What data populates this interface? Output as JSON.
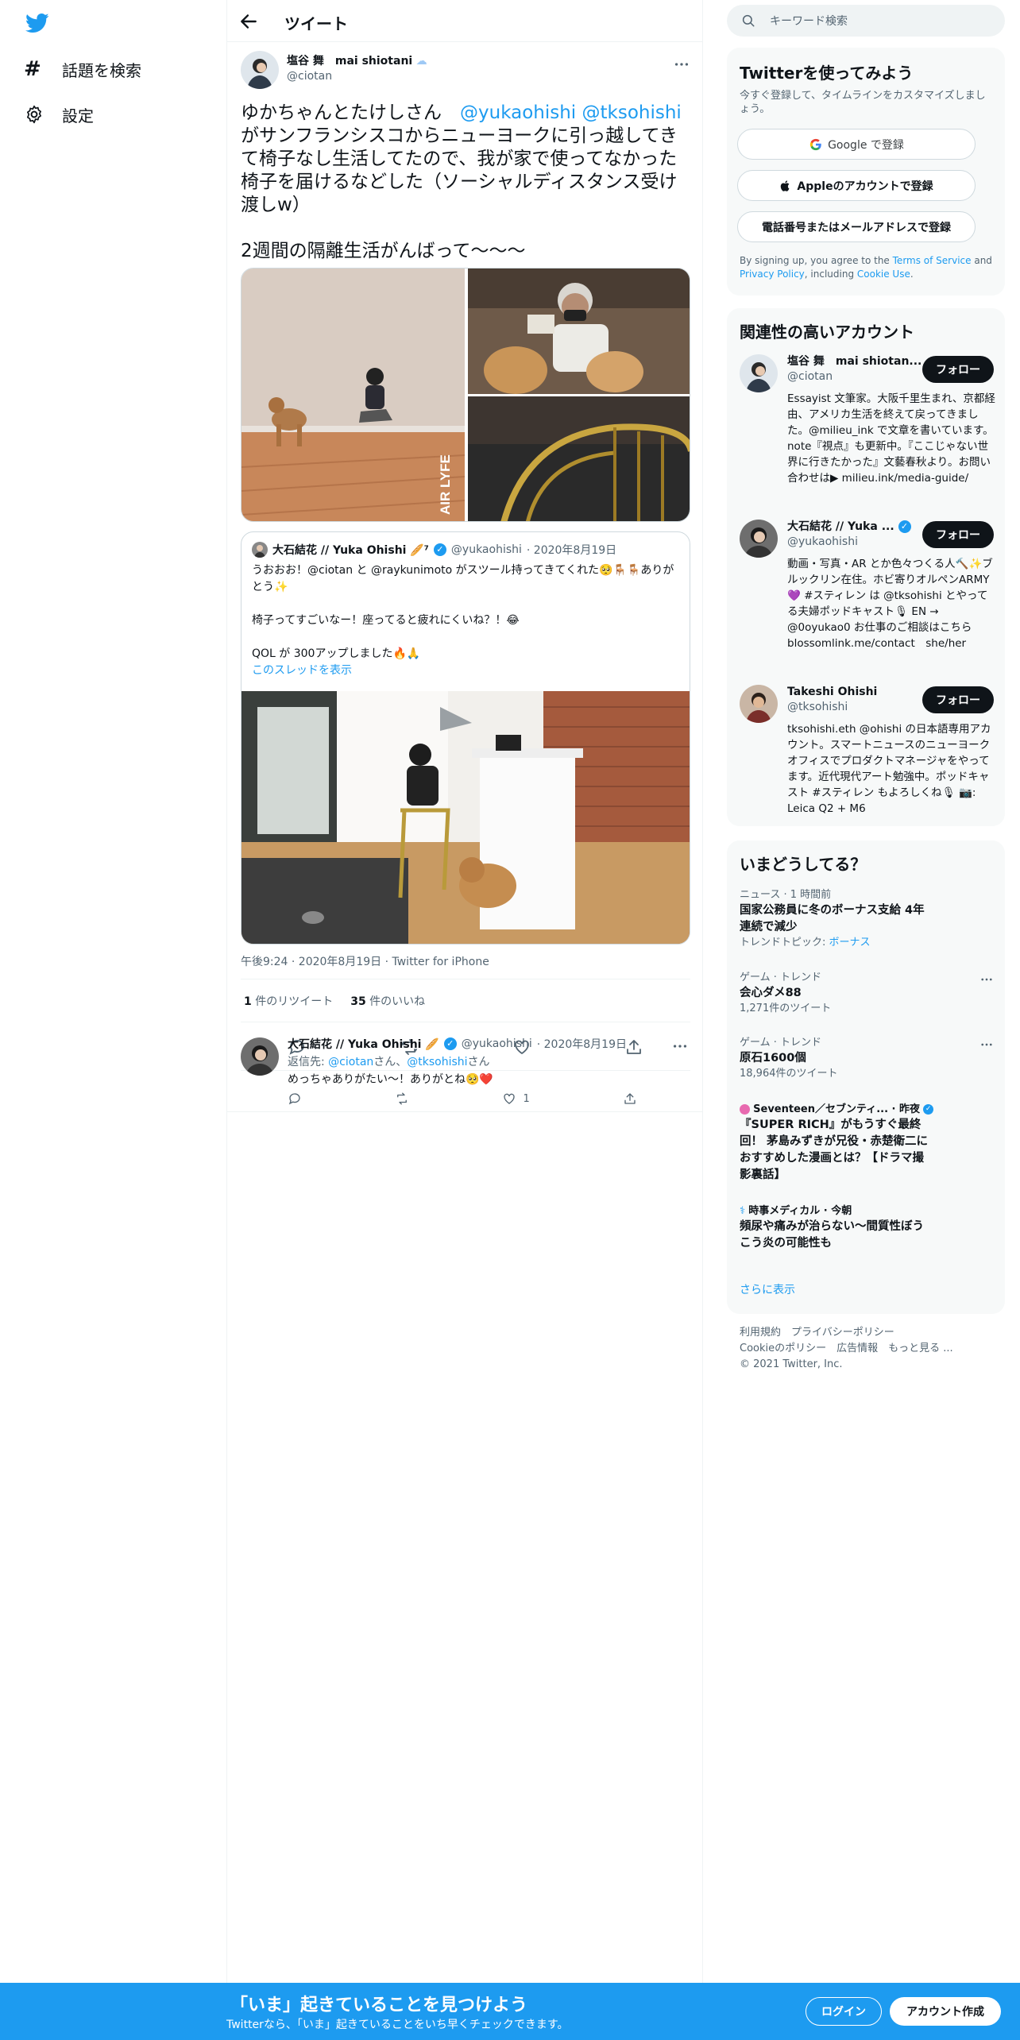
{
  "nav": {
    "explore": "話題を検索",
    "settings": "設定"
  },
  "header": {
    "title": "ツイート"
  },
  "tweet": {
    "name": "塩谷 舞　mai shiotani",
    "handle": "@ciotan",
    "text_pre": "ゆかちゃんとたけしさん　",
    "mention1": "@yukaohishi",
    "mention2": "@tksohishi",
    "text_post": "がサンフランシスコからニューヨークに引っ越してきて椅子なし生活してたので、我が家で使ってなかった椅子を届けるなどした（ソーシャルディスタンス受け渡しw）\n\n2週間の隔離生活がんばって〜〜〜",
    "watermark": "AIR LYFE",
    "time": "午後9:24 · 2020年8月19日 · Twitter for iPhone",
    "retweets_n": "1",
    "retweets_label": " 件のリツイート",
    "likes_n": "35",
    "likes_label": " 件のいいね"
  },
  "quote": {
    "name": "大石結花 // Yuka Ohishi 🥖⁷",
    "handle": "@yukaohishi",
    "date": "· 2020年8月19日",
    "text": "うおおお！@ciotan と @raykunimoto がスツール持ってきてくれた🥺🪑🪑ありがとう✨\n\n椅子ってすごいなー！座ってると疲れにくいね？！😂\n\nQOL が 300アップしました🔥🙏",
    "thread": "このスレッドを表示"
  },
  "reply": {
    "name": "大石結花 // Yuka Ohishi 🥖",
    "handle": "@yukaohishi",
    "date": "· 2020年8月19日",
    "to_label": "返信先: ",
    "to1": "@ciotan",
    "to_mid": "さん、",
    "to2": "@tksohishi",
    "to_end": "さん",
    "text": "めっちゃありがたい〜！ありがとね🥺❤️",
    "likes": "1"
  },
  "search": {
    "placeholder": "キーワード検索"
  },
  "signup": {
    "title": "Twitterを使ってみよう",
    "sub": "今すぐ登録して、タイムラインをカスタマイズしましょう。",
    "google": "Google で登録",
    "apple": "Appleのアカウントで登録",
    "phone": "電話番号またはメールアドレスで登録",
    "legal_pre": "By signing up, you agree to the ",
    "terms": "Terms of Service",
    "and": " and ",
    "privacy": "Privacy Policy",
    "including": ", including ",
    "cookie": "Cookie Use",
    "period": "."
  },
  "related": {
    "title": "関連性の高いアカウント",
    "follow": "フォロー",
    "accounts": [
      {
        "name": "塩谷 舞　mai shiotan...",
        "handle": "@ciotan",
        "bio": "Essayist 文筆家。大阪千里生まれ、京都経由、アメリカ生活を終えて戻ってきました。@milieu_ink で文章を書いています。note『視点』も更新中。『ここじゃない世界に行きたかった』文藝春秋より。お問い合わせは▶ milieu.ink/media-guide/"
      },
      {
        "name": "大石結花 // Yuka ...",
        "handle": "@yukaohishi",
        "bio": "動画・写真・AR とか色々つくる人🔨✨ブルックリン在住。ホビ寄りオルペンARMY💜 #スティレン は @tksohishi とやってる夫婦ポッドキャスト🎙 EN → @0oyukao0 お仕事のご相談はこちら blossomlink.me/contact　she/her"
      },
      {
        "name": "Takeshi Ohishi",
        "handle": "@tksohishi",
        "bio": "tksohishi.eth @ohishi の日本語専用アカウント。スマートニュースのニューヨークオフィスでプロダクトマネージャをやってます。近代現代アート勉強中。ポッドキャスト #スティレン もよろしくね🎙 📷: Leica Q2 + M6"
      }
    ]
  },
  "trends": {
    "title": "いまどうしてる？",
    "items": [
      {
        "cat": "ニュース · 1 時間前",
        "title": "国家公務員に冬のボーナス支給 4年連続で減少",
        "sub_label": "トレンドトピック: ",
        "sub_link": "ボーナス"
      },
      {
        "cat": "ゲーム · トレンド",
        "title": "会心ダメ88",
        "sub": "1,271件のツイート"
      },
      {
        "cat": "ゲーム · トレンド",
        "title": "原石1600個",
        "sub": "18,964件のツイート"
      },
      {
        "cat": "Seventeen／セブンティ... · 昨夜",
        "title": "『SUPER RICH』がもうすぐ最終回！ 茅島みずきが兄役・赤楚衛二におすすめした漫画とは？【ドラマ撮影裏話】"
      },
      {
        "cat": "時事メディカル · 今朝",
        "title": "頻尿や痛みが治らない～間質性ぼうこう炎の可能性も"
      }
    ],
    "more": "さらに表示"
  },
  "footer": {
    "l1": "利用規約　プライバシーポリシー",
    "l2": "Cookieのポリシー　広告情報　もっと見る ...",
    "l3": "© 2021 Twitter, Inc."
  },
  "bottom": {
    "title": "「いま」起きていることを見つけよう",
    "sub": "Twitterなら、「いま」起きていることをいち早くチェックできます。",
    "login": "ログイン",
    "signup": "アカウント作成"
  },
  "colors": {
    "accent": "#1d9bf0",
    "text": "#0f1419",
    "muted": "#536471",
    "like_heart": "#f91880"
  }
}
